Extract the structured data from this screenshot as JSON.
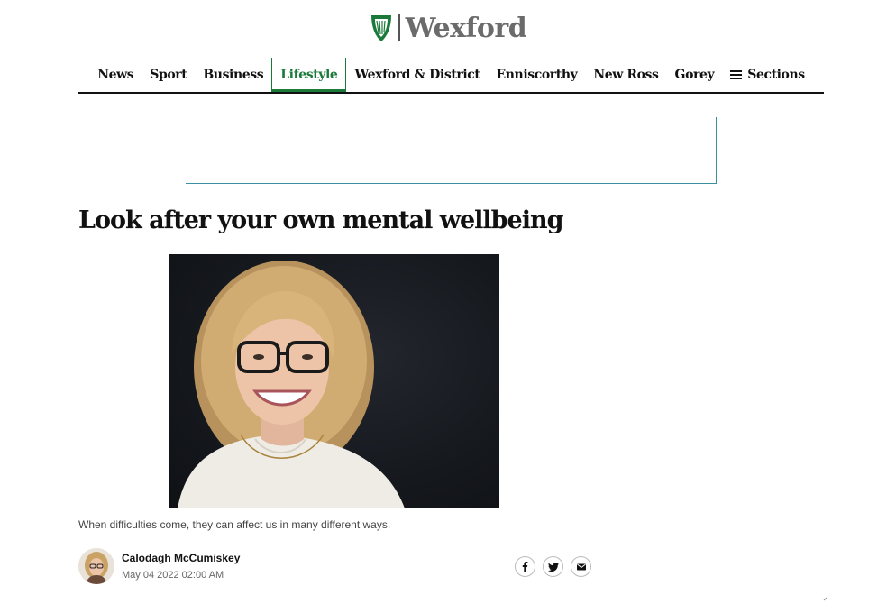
{
  "brand": {
    "name": "Wexford",
    "color": "#1b7a3a"
  },
  "nav": {
    "items": [
      {
        "label": "News"
      },
      {
        "label": "Sport"
      },
      {
        "label": "Business"
      },
      {
        "label": "Lifestyle",
        "active": true
      },
      {
        "label": "Wexford & District"
      },
      {
        "label": "Enniscorthy"
      },
      {
        "label": "New Ross"
      },
      {
        "label": "Gorey"
      }
    ],
    "sections_label": "Sections",
    "sections_icon": "hamburger-icon"
  },
  "article": {
    "headline": "Look after your own mental wellbeing",
    "caption": "When difficulties come, they can affect us in many different ways.",
    "author": "Calodagh McCumiskey",
    "date": "May 04 2022 02:00 AM"
  },
  "share": {
    "icons": [
      "facebook-icon",
      "twitter-icon",
      "email-icon"
    ]
  }
}
